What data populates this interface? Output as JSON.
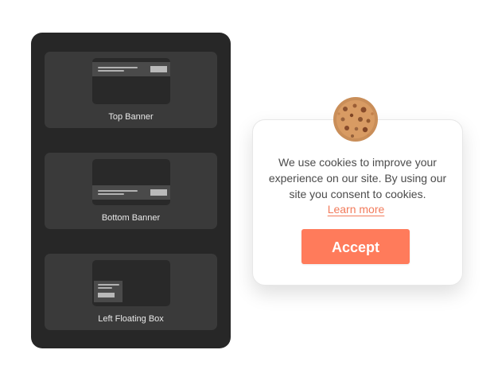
{
  "layout_options": [
    {
      "label": "Top Banner",
      "style": "top-banner"
    },
    {
      "label": "Bottom Banner",
      "style": "bottom-banner"
    },
    {
      "label": "Left Floating Box",
      "style": "left-floating-box"
    }
  ],
  "cookie_banner": {
    "message": "We use cookies to improve your experience on our site. By using our site you consent to cookies.",
    "learn_more": "Learn more",
    "accept_label": "Accept",
    "icon": "cookie-icon"
  },
  "colors": {
    "panel": "#272727",
    "card": "#3a3a3a",
    "accent": "#ff7b5b",
    "link": "#f27b5b"
  }
}
